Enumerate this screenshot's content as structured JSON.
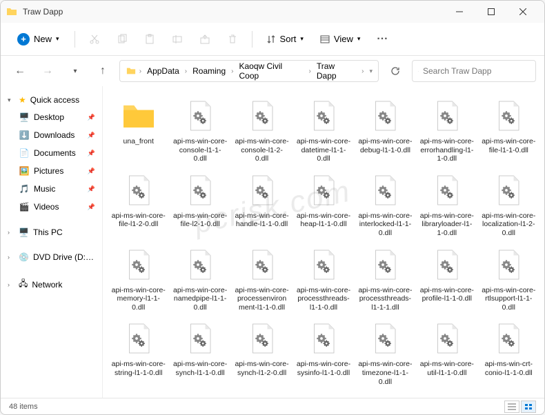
{
  "window": {
    "title": "Traw Dapp"
  },
  "toolbar": {
    "new_label": "New",
    "sort_label": "Sort",
    "view_label": "View"
  },
  "breadcrumb": {
    "items": [
      "AppData",
      "Roaming",
      "Kaoqw Civil Coop",
      "Traw Dapp"
    ]
  },
  "search": {
    "placeholder": "Search Traw Dapp"
  },
  "sidebar": {
    "quick_access": "Quick access",
    "items": [
      {
        "label": "Desktop",
        "icon": "desktop",
        "pinned": true
      },
      {
        "label": "Downloads",
        "icon": "downloads",
        "pinned": true
      },
      {
        "label": "Documents",
        "icon": "documents",
        "pinned": true
      },
      {
        "label": "Pictures",
        "icon": "pictures",
        "pinned": true
      },
      {
        "label": "Music",
        "icon": "music",
        "pinned": true
      },
      {
        "label": "Videos",
        "icon": "videos",
        "pinned": true
      }
    ],
    "this_pc": "This PC",
    "dvd": "DVD Drive (D:) CCCC",
    "network": "Network"
  },
  "files": [
    {
      "name": "una_front",
      "type": "folder"
    },
    {
      "name": "api-ms-win-core-console-l1-1-0.dll",
      "type": "dll"
    },
    {
      "name": "api-ms-win-core-console-l1-2-0.dll",
      "type": "dll"
    },
    {
      "name": "api-ms-win-core-datetime-l1-1-0.dll",
      "type": "dll"
    },
    {
      "name": "api-ms-win-core-debug-l1-1-0.dll",
      "type": "dll"
    },
    {
      "name": "api-ms-win-core-errorhandling-l1-1-0.dll",
      "type": "dll"
    },
    {
      "name": "api-ms-win-core-file-l1-1-0.dll",
      "type": "dll"
    },
    {
      "name": "api-ms-win-core-file-l1-2-0.dll",
      "type": "dll"
    },
    {
      "name": "api-ms-win-core-file-l2-1-0.dll",
      "type": "dll"
    },
    {
      "name": "api-ms-win-core-handle-l1-1-0.dll",
      "type": "dll"
    },
    {
      "name": "api-ms-win-core-heap-l1-1-0.dll",
      "type": "dll"
    },
    {
      "name": "api-ms-win-core-interlocked-l1-1-0.dll",
      "type": "dll"
    },
    {
      "name": "api-ms-win-core-libraryloader-l1-1-0.dll",
      "type": "dll"
    },
    {
      "name": "api-ms-win-core-localization-l1-2-0.dll",
      "type": "dll"
    },
    {
      "name": "api-ms-win-core-memory-l1-1-0.dll",
      "type": "dll"
    },
    {
      "name": "api-ms-win-core-namedpipe-l1-1-0.dll",
      "type": "dll"
    },
    {
      "name": "api-ms-win-core-processenvironment-l1-1-0.dll",
      "type": "dll"
    },
    {
      "name": "api-ms-win-core-processthreads-l1-1-0.dll",
      "type": "dll"
    },
    {
      "name": "api-ms-win-core-processthreads-l1-1-1.dll",
      "type": "dll"
    },
    {
      "name": "api-ms-win-core-profile-l1-1-0.dll",
      "type": "dll"
    },
    {
      "name": "api-ms-win-core-rtlsupport-l1-1-0.dll",
      "type": "dll"
    },
    {
      "name": "api-ms-win-core-string-l1-1-0.dll",
      "type": "dll"
    },
    {
      "name": "api-ms-win-core-synch-l1-1-0.dll",
      "type": "dll"
    },
    {
      "name": "api-ms-win-core-synch-l1-2-0.dll",
      "type": "dll"
    },
    {
      "name": "api-ms-win-core-sysinfo-l1-1-0.dll",
      "type": "dll"
    },
    {
      "name": "api-ms-win-core-timezone-l1-1-0.dll",
      "type": "dll"
    },
    {
      "name": "api-ms-win-core-util-l1-1-0.dll",
      "type": "dll"
    },
    {
      "name": "api-ms-win-crt-conio-l1-1-0.dll",
      "type": "dll"
    }
  ],
  "status": {
    "count": "48 items"
  },
  "watermark": "pcrisk.com"
}
